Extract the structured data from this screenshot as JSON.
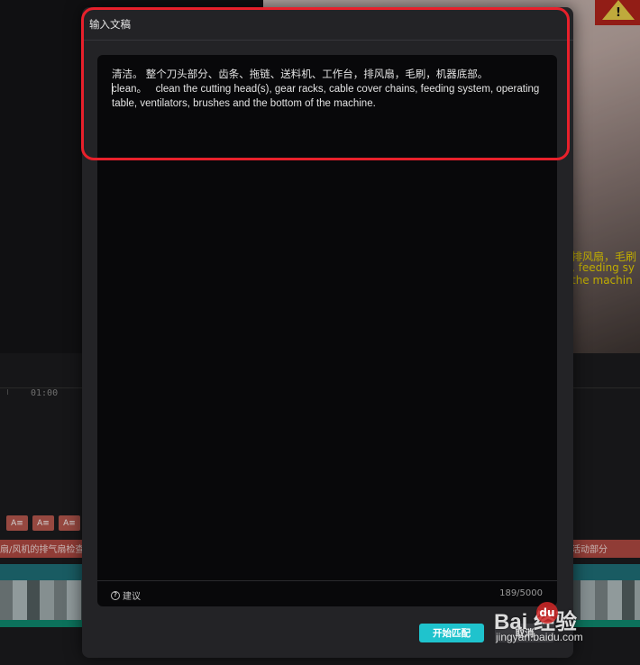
{
  "modal": {
    "title": "输入文稿",
    "editor_text": "清洁。 整个刀头部分、齿条、拖链、送料机、工作台，排风扇，毛刷，机器底部。\nclean。   clean the cutting head(s), gear racks, cable cover chains, feeding system, operating table, ventilators, brushes and the bottom of the machine.",
    "suggest_label": "建议",
    "suggest_icon": "question-circle-icon",
    "char_count": "189/5000",
    "start_match_label": "开始匹配",
    "cancel_label": "取消"
  },
  "background": {
    "timeline_time": "01:00",
    "preview_subtitles": [
      "排风扇，毛刷",
      ", feeding sy",
      "the machin"
    ],
    "text_chip_label": "A≡",
    "clip_labels": [
      "扇/风机的排气扇检查",
      "活动部分"
    ]
  },
  "annotation": {
    "highlight_color": "#e8202b"
  },
  "watermark": {
    "logo": "Bai  经验",
    "url": "jingyan.baidu.com"
  },
  "colors": {
    "accent": "#1fc3cd",
    "modal_bg": "#232326",
    "editor_bg": "#08080a",
    "subtitle_track": "#b04a42",
    "video_track": "#1f6f78"
  }
}
